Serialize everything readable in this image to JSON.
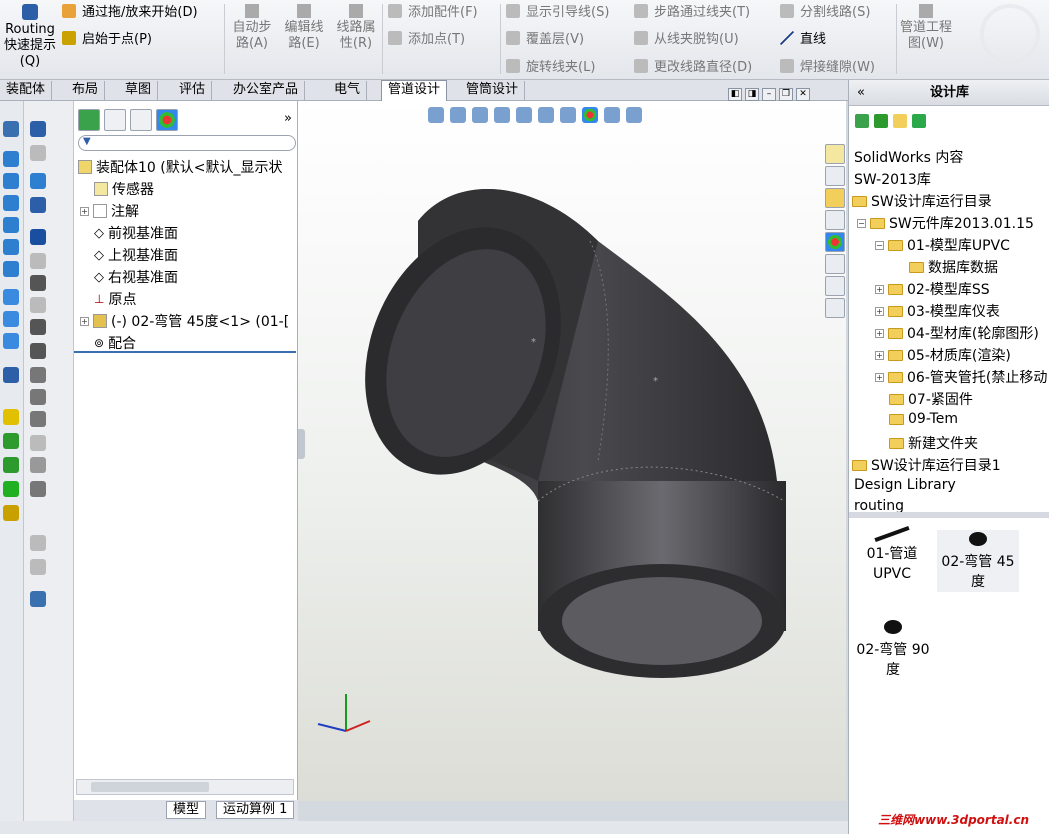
{
  "ribbon": {
    "routing_quick": "Routing 快速提示(Q)",
    "drag_drop_start": "通过拖/放来开始(D)",
    "start_at_point": "启始于点(P)",
    "auto_route": "自动步路(A)",
    "edit_route": "编辑线路(E)",
    "route_props": "线路属性(R)",
    "add_fitting": "添加配件(F)",
    "add_point": "添加点(T)",
    "show_guidelines": "显示引导线(S)",
    "cover_layer": "覆盖层(V)",
    "rotate_clip": "旋转线夹(L)",
    "route_through_clip": "步路通过线夹(T)",
    "unhook_clip": "从线夹脱钩(U)",
    "change_route_dia": "更改线路直径(D)",
    "split_route": "分割线路(S)",
    "line": "直线",
    "weld_gap": "焊接缝隙(W)",
    "pipe_drawing": "管道工程图(W)"
  },
  "tabs": [
    "装配体",
    "布局",
    "草图",
    "评估",
    "办公室产品",
    "电气",
    "管道设计",
    "管筒设计"
  ],
  "active_tab": "管道设计",
  "tree": {
    "root": "装配体10 (默认<默认_显示状",
    "items": [
      "传感器",
      "注解",
      "前视基准面",
      "上视基准面",
      "右视基准面",
      "原点",
      "(-) 02-弯管 45度<1> (01-[",
      "配合"
    ]
  },
  "bottom_tabs": [
    "模型",
    "运动算例 1"
  ],
  "library": {
    "title": "设计库",
    "nodes": [
      "SolidWorks 内容",
      "SW-2013库",
      "SW设计库运行目录",
      "SW元件库2013.01.15",
      "01-模型库UPVC",
      "数据库数据",
      "02-模型库SS",
      "03-模型库仪表",
      "04-型材库(轮廓图形)",
      "05-材质库(渲染)",
      "06-管夹管托(禁止移动",
      "07-紧固件",
      "09-Tem",
      "新建文件夹",
      "SW设计库运行目录1",
      "Design Library",
      "routing"
    ],
    "items": [
      "01-管道UPVC",
      "02-弯管 45度",
      "02-弯管 90度"
    ]
  },
  "watermark": "三维网www.3dportal.cn",
  "colors": {
    "accent": "#3a6fb0",
    "pipe": "#3d3d40",
    "folder": "#f2cf5a"
  }
}
